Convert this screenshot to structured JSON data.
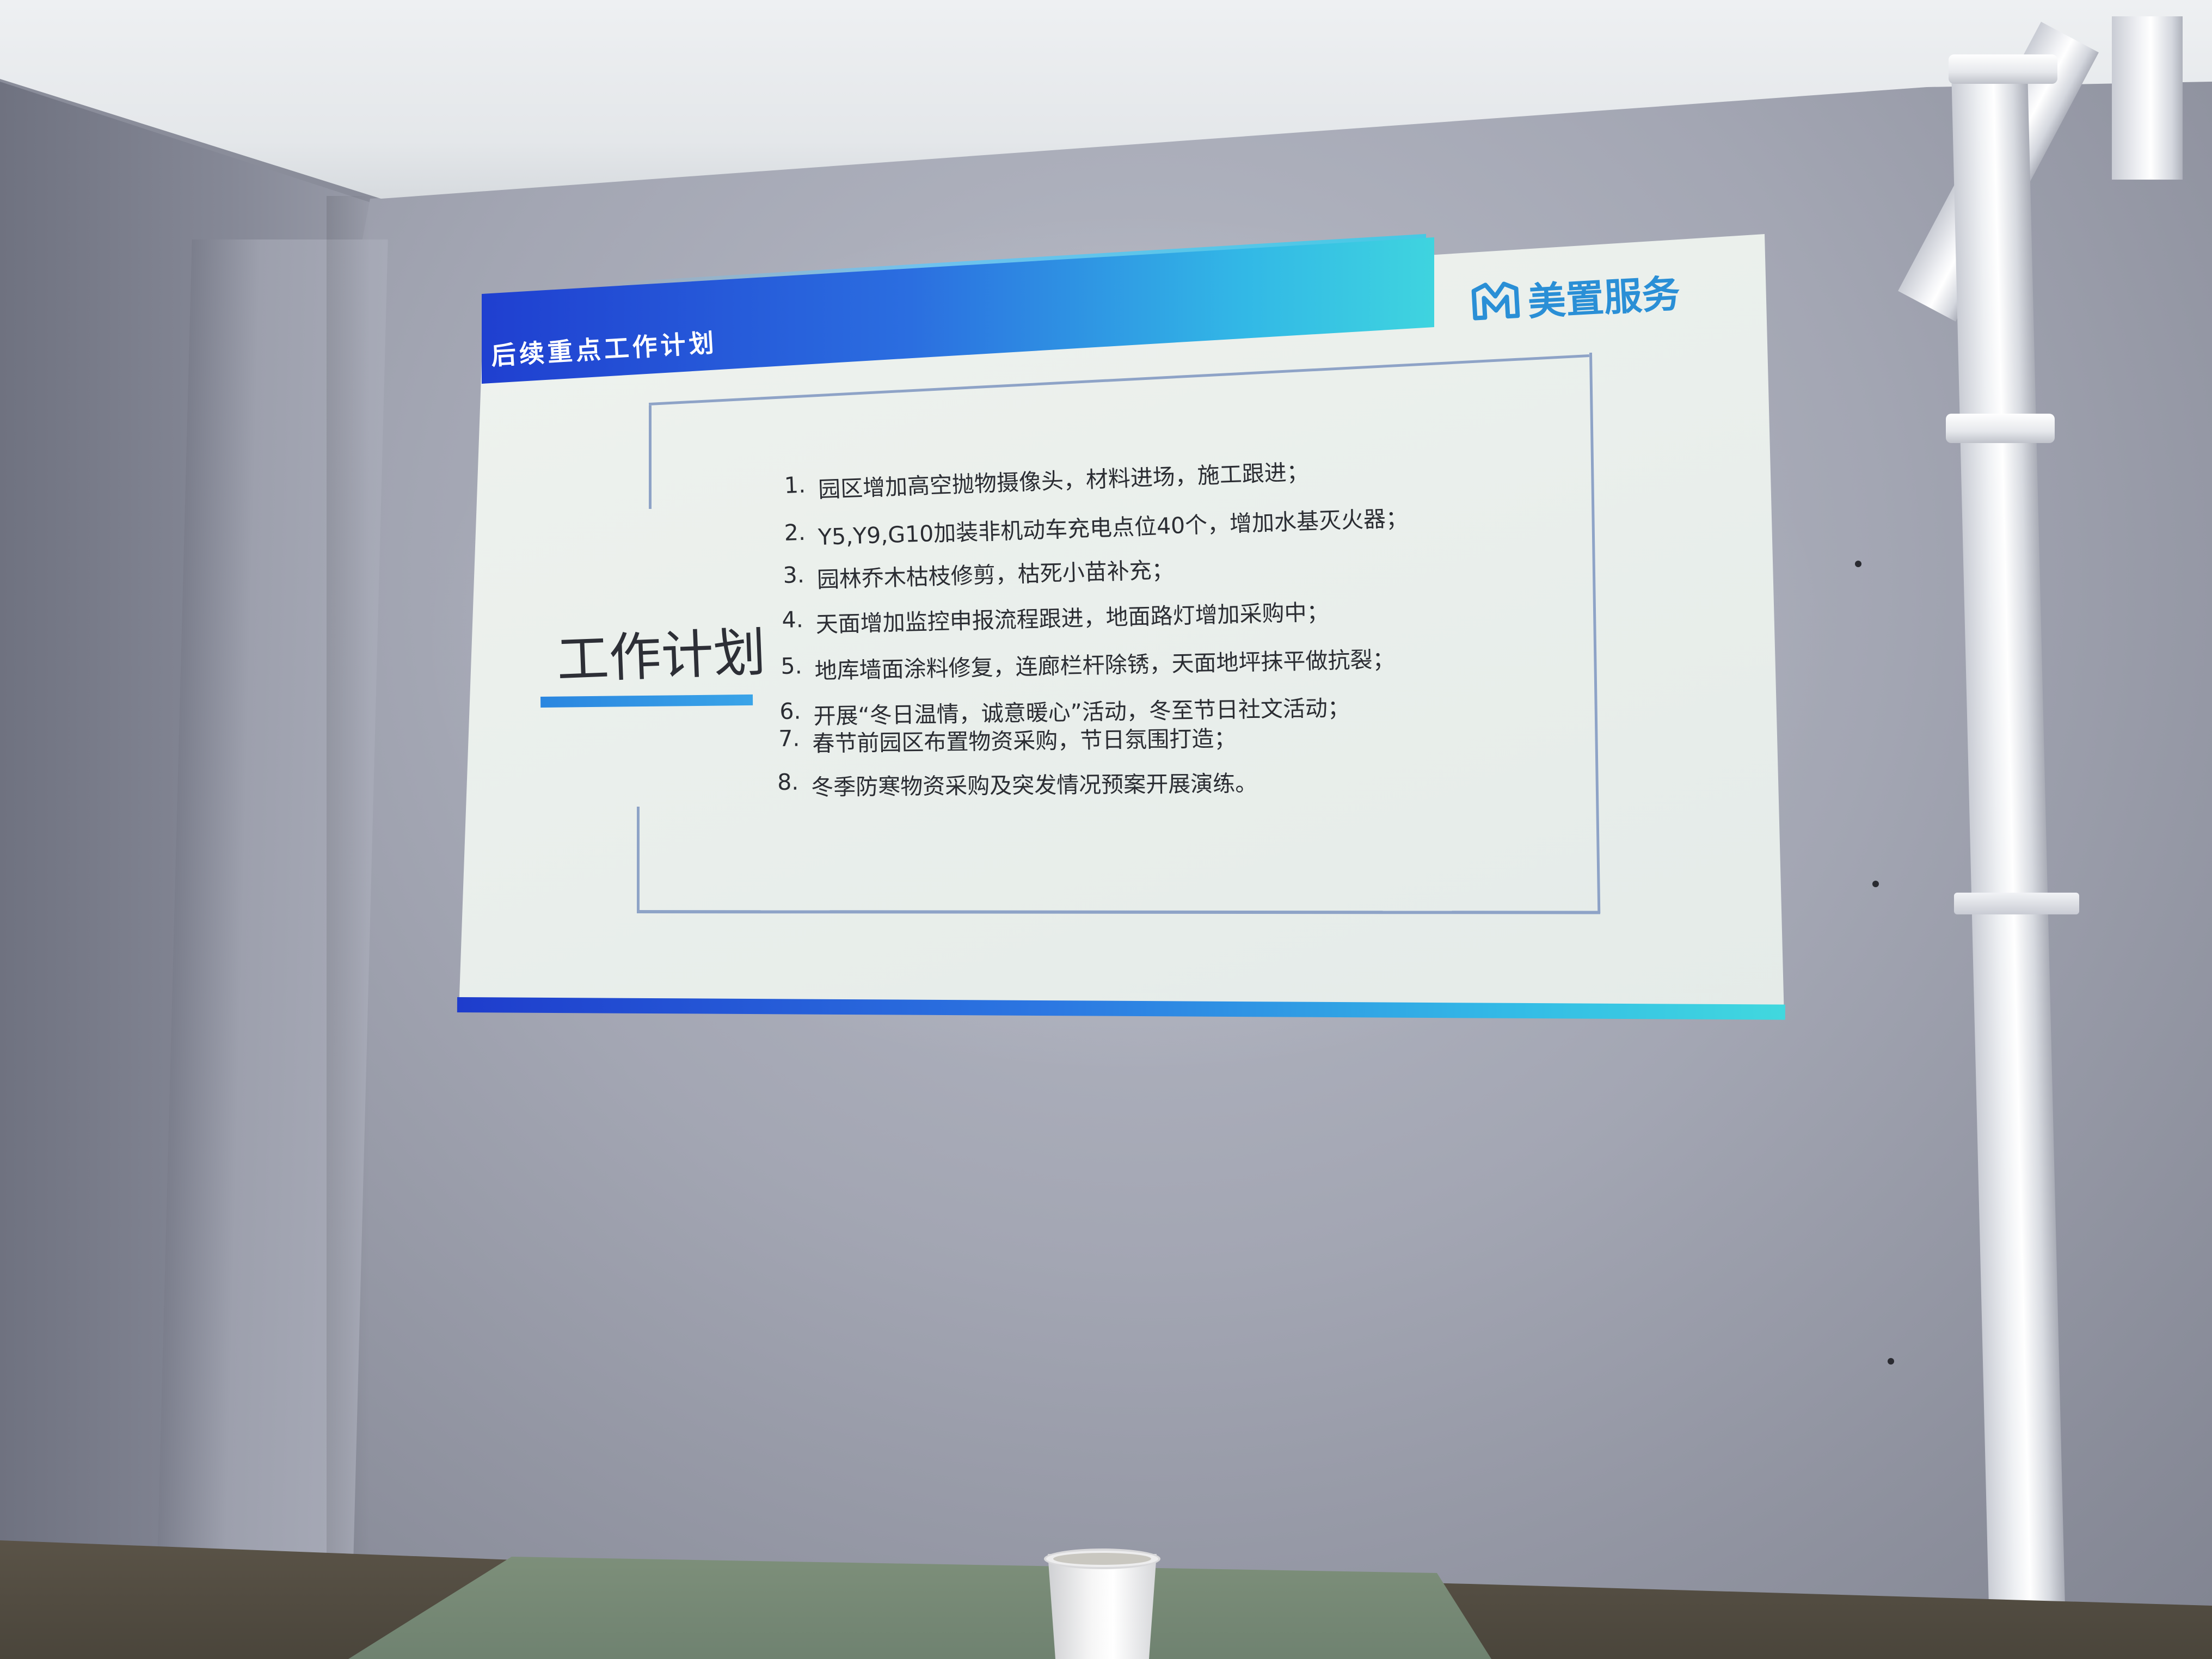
{
  "slide": {
    "title": "后续重点工作计划",
    "logo_text": "美置服务",
    "logo_icon": "mz-logo-icon",
    "section_heading": "工作计划",
    "items": [
      {
        "num": "1.",
        "text": "园区增加高空抛物摄像头，材料进场，施工跟进；"
      },
      {
        "num": "2.",
        "text": "Y5,Y9,G10加装非机动车充电点位40个，增加水基灭火器；"
      },
      {
        "num": "3.",
        "text": "园林乔木枯枝修剪，枯死小苗补充；"
      },
      {
        "num": "4.",
        "text": "天面增加监控申报流程跟进，地面路灯增加采购中；"
      },
      {
        "num": "5.",
        "text": "地库墙面涂料修复，连廊栏杆除锈，天面地坪抹平做抗裂；"
      },
      {
        "num": "6.",
        "text": "开展“冬日温情，诚意暖心”活动，冬至节日社文活动；"
      },
      {
        "num": "7.",
        "text": "春节前园区布置物资采购，节日氛围打造；"
      },
      {
        "num": "8.",
        "text": "冬季防寒物资采购及突发情况预案开展演练。"
      }
    ]
  },
  "colors": {
    "title_bar_start": "#1f3fd0",
    "title_bar_end": "#3fd4df",
    "logo": "#2a8fd6",
    "accent_underline": "#2a86e0",
    "frame": "#8ea3c7"
  }
}
